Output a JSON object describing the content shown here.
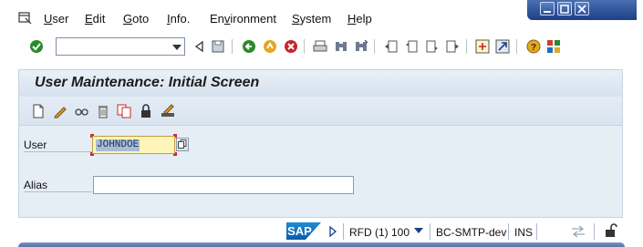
{
  "menu": {
    "items": [
      "User",
      "Edit",
      "Goto",
      "Info.",
      "Environment",
      "System",
      "Help"
    ],
    "mnemonics": [
      "U",
      "E",
      "G",
      "I",
      "v",
      "S",
      "H"
    ]
  },
  "toolbar": {
    "command_field_value": "",
    "icons": [
      "enter-check-icon",
      "back-icon",
      "save-icon",
      "back-green-icon",
      "exit-icon",
      "cancel-icon",
      "print-icon",
      "find-icon",
      "find-next-icon",
      "first-page-icon",
      "previous-page-icon",
      "next-page-icon",
      "last-page-icon",
      "create-session-icon",
      "shortcut-icon",
      "help-icon",
      "customize-layout-icon"
    ]
  },
  "title": "User Maintenance: Initial Screen",
  "app_toolbar": {
    "icons": [
      "create-icon",
      "change-icon",
      "display-icon",
      "delete-icon",
      "copy-icon",
      "lock-icon",
      "change-password-icon"
    ]
  },
  "form": {
    "user_label": "User",
    "user_value": "JOHNDOE",
    "alias_label": "Alias",
    "alias_value": ""
  },
  "status": {
    "logo_text": "SAP",
    "system": "RFD (1) 100",
    "host": "BC-SMTP-dev",
    "mode": "INS"
  },
  "colors": {
    "title_bg": "#d6e2ef",
    "field_required_bg": "#fff5b8",
    "sap_blue": "#0a5ca7"
  }
}
